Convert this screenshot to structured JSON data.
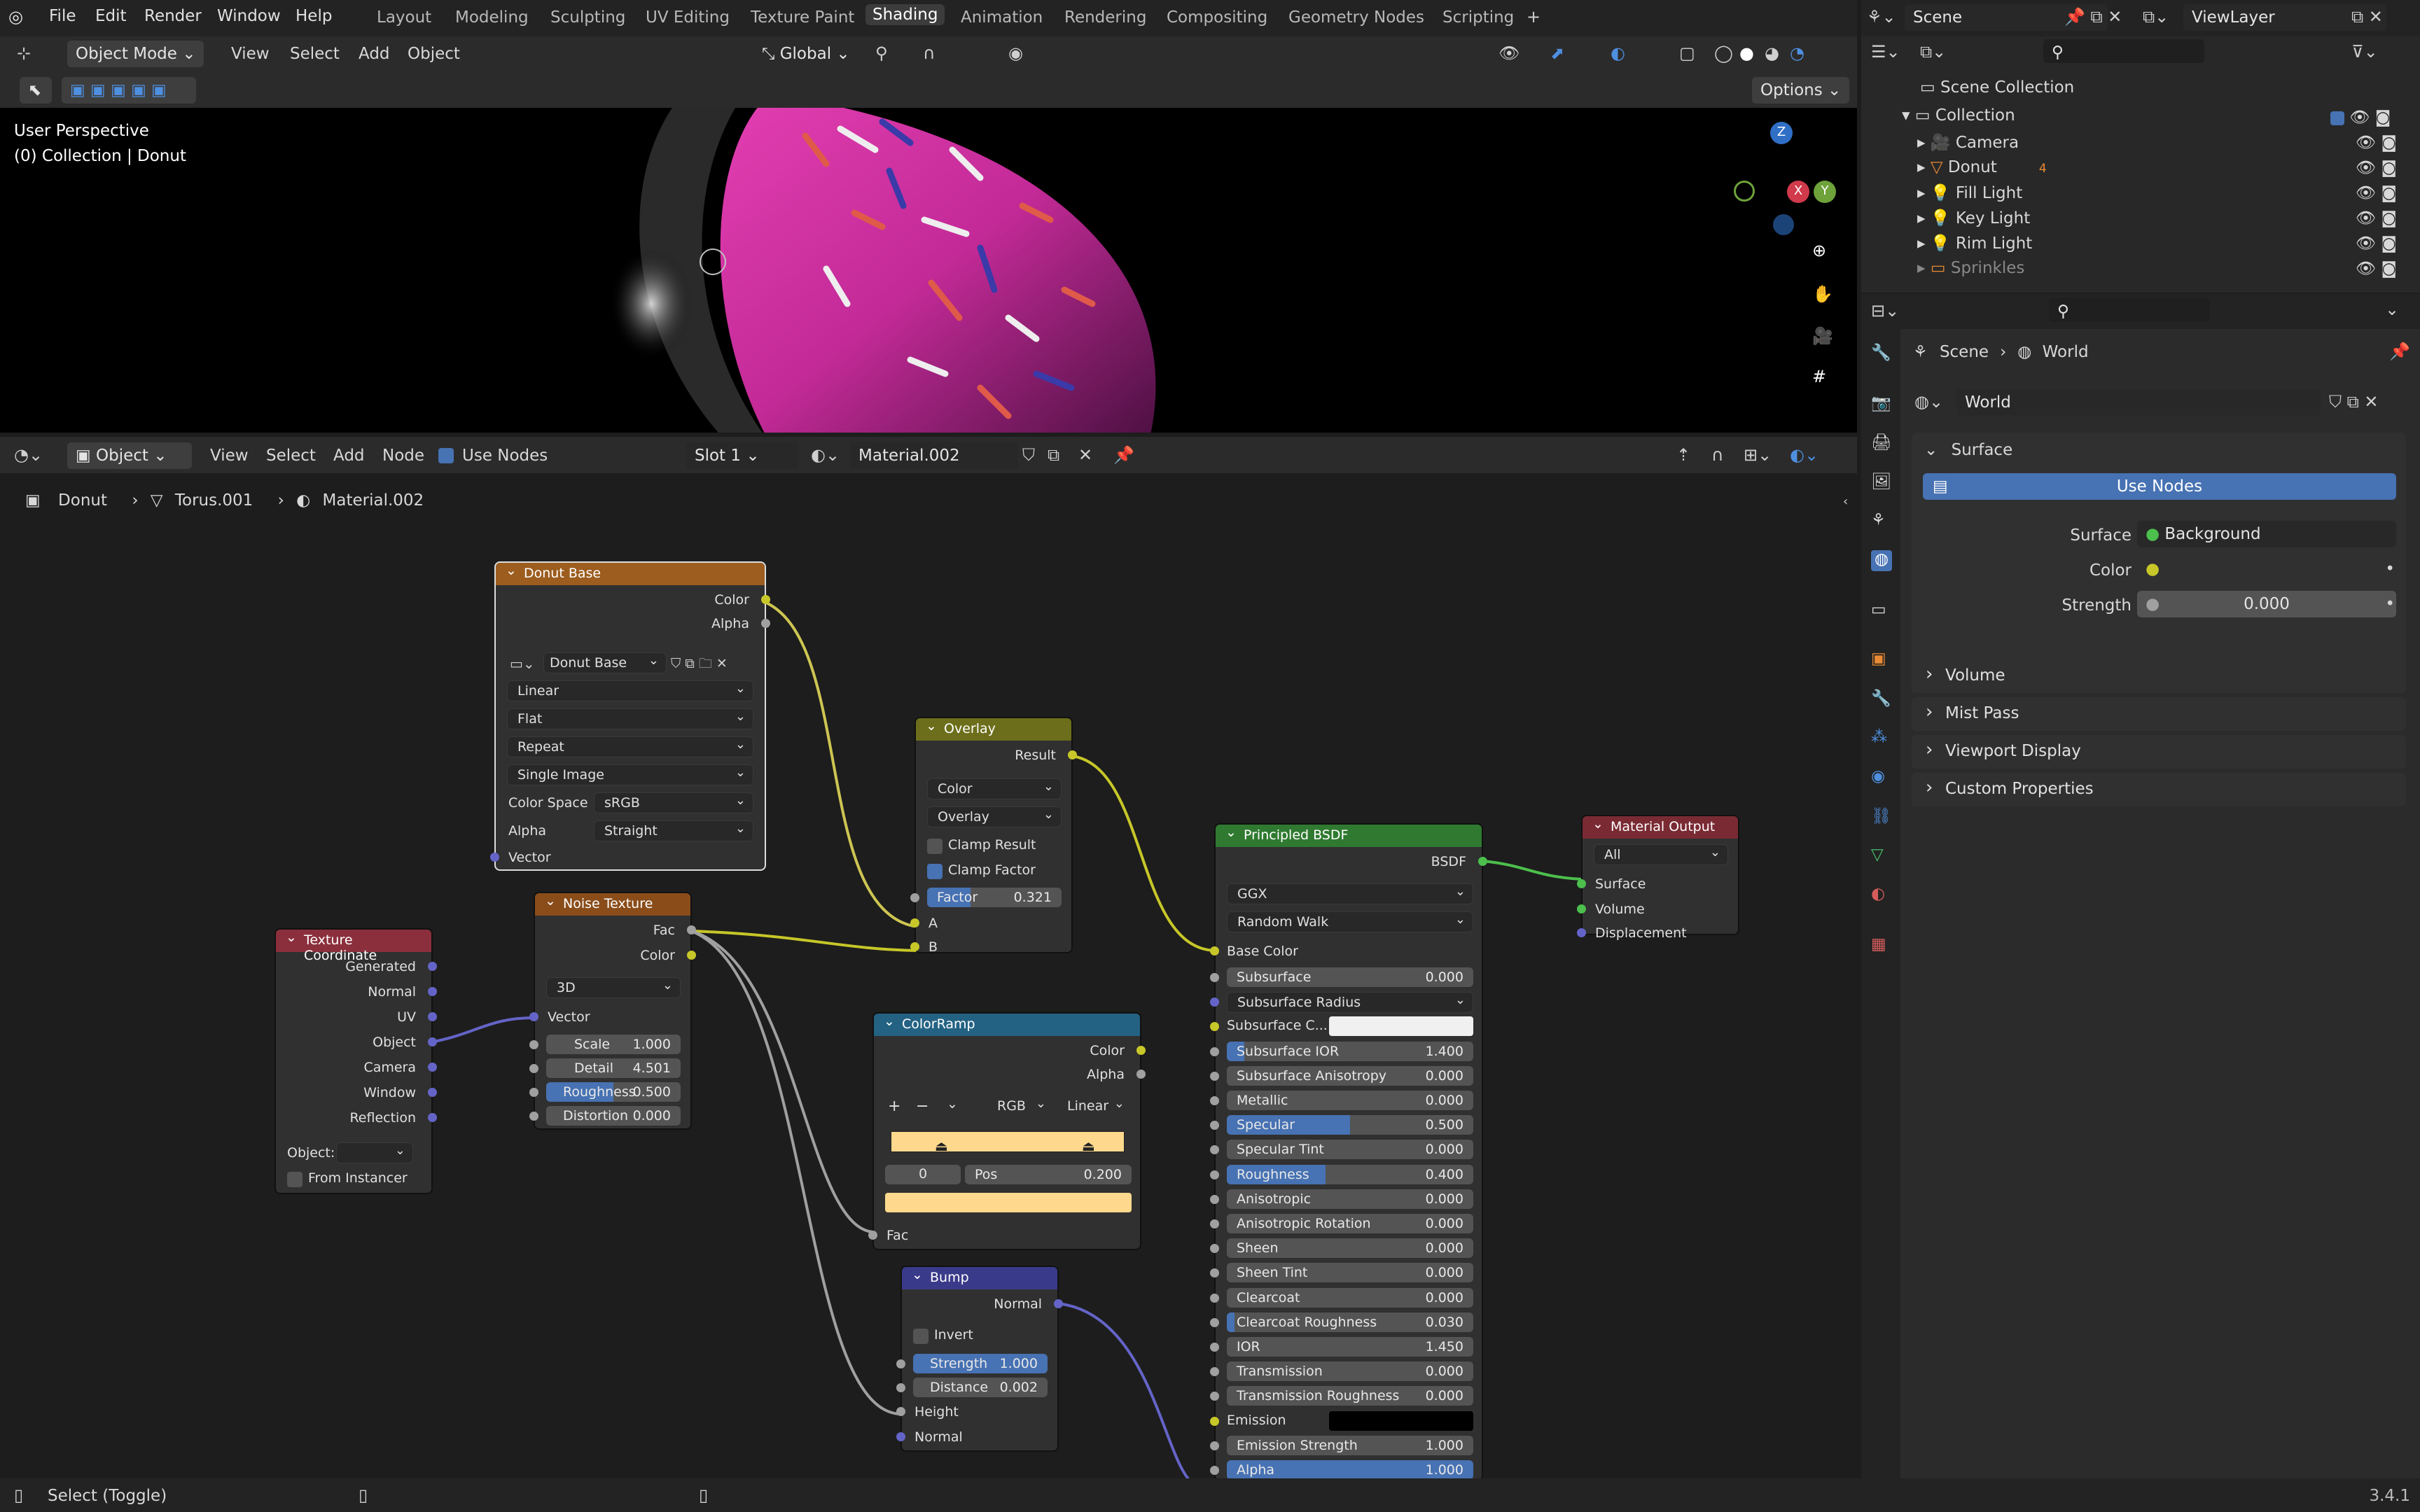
{
  "menu": {
    "file": "File",
    "edit": "Edit",
    "render": "Render",
    "window": "Window",
    "help": "Help"
  },
  "workspaces": [
    "Layout",
    "Modeling",
    "Sculpting",
    "UV Editing",
    "Texture Paint",
    "Shading",
    "Animation",
    "Rendering",
    "Compositing",
    "Geometry Nodes",
    "Scripting"
  ],
  "active_workspace": "Shading",
  "scene_selector": {
    "scene": "Scene",
    "view_layer": "ViewLayer"
  },
  "viewport_header": {
    "mode": "Object Mode",
    "view": "View",
    "select": "Select",
    "add": "Add",
    "object": "Object",
    "transform": "Global",
    "options": "Options"
  },
  "viewport": {
    "perspective": "User Perspective",
    "collection_info": "(0) Collection | Donut",
    "gizmo": {
      "z": "Z",
      "x": "X",
      "y": "Y"
    }
  },
  "node_header": {
    "editor_type": "Object",
    "view": "View",
    "select": "Select",
    "add": "Add",
    "node": "Node",
    "use_nodes": "Use Nodes",
    "slot": "Slot 1",
    "material": "Material.002"
  },
  "breadcrumb": {
    "object": "Donut",
    "mesh": "Torus.001",
    "material": "Material.002"
  },
  "nodes": {
    "donut_base": {
      "title": "Donut Base",
      "color": "Color",
      "alpha": "Alpha",
      "image": "Donut Base",
      "interpolation": "Linear",
      "projection": "Flat",
      "extension": "Repeat",
      "source": "Single Image",
      "color_space_label": "Color Space",
      "color_space": "sRGB",
      "alpha_label": "Alpha",
      "alpha_mode": "Straight",
      "vector": "Vector"
    },
    "overlay": {
      "title": "Overlay",
      "result": "Result",
      "type": "Color",
      "blend": "Overlay",
      "clamp_result": "Clamp Result",
      "clamp_factor": "Clamp Factor",
      "factor_label": "Factor",
      "factor": "0.321",
      "factor_fraction": 0.321,
      "a": "A",
      "b": "B"
    },
    "principled": {
      "title": "Principled BSDF",
      "bsdf": "BSDF",
      "distribution": "GGX",
      "subsurface_method": "Random Walk",
      "base_color": "Base Color",
      "fields": [
        {
          "label": "Subsurface",
          "value": "0.000",
          "fill": 0
        },
        {
          "label": "Subsurface Radius",
          "value": "",
          "dropdown": true
        },
        {
          "label": "Subsurface C...",
          "value": "",
          "colorbox": "#f0f0f0"
        },
        {
          "label": "Subsurface IOR",
          "value": "1.400",
          "fill": 0.07
        },
        {
          "label": "Subsurface Anisotropy",
          "value": "0.000",
          "fill": 0
        },
        {
          "label": "Metallic",
          "value": "0.000",
          "fill": 0
        },
        {
          "label": "Specular",
          "value": "0.500",
          "fill": 0.5
        },
        {
          "label": "Specular Tint",
          "value": "0.000",
          "fill": 0
        },
        {
          "label": "Roughness",
          "value": "0.400",
          "fill": 0.4
        },
        {
          "label": "Anisotropic",
          "value": "0.000",
          "fill": 0
        },
        {
          "label": "Anisotropic Rotation",
          "value": "0.000",
          "fill": 0
        },
        {
          "label": "Sheen",
          "value": "0.000",
          "fill": 0
        },
        {
          "label": "Sheen Tint",
          "value": "0.000",
          "fill": 0
        },
        {
          "label": "Clearcoat",
          "value": "0.000",
          "fill": 0
        },
        {
          "label": "Clearcoat Roughness",
          "value": "0.030",
          "fill": 0.03
        },
        {
          "label": "IOR",
          "value": "1.450",
          "fill": 0
        },
        {
          "label": "Transmission",
          "value": "0.000",
          "fill": 0
        },
        {
          "label": "Transmission Roughness",
          "value": "0.000",
          "fill": 0
        },
        {
          "label": "Emission",
          "value": "",
          "colorbox": "#000000"
        },
        {
          "label": "Emission Strength",
          "value": "1.000",
          "fill": 0
        },
        {
          "label": "Alpha",
          "value": "1.000",
          "fill": 1
        }
      ]
    },
    "material_output": {
      "title": "Material Output",
      "target": "All",
      "surface": "Surface",
      "volume": "Volume",
      "displacement": "Displacement"
    },
    "texture_coordinate": {
      "title": "Texture Coordinate",
      "outputs": [
        "Generated",
        "Normal",
        "UV",
        "Object",
        "Camera",
        "Window",
        "Reflection"
      ],
      "object_label": "Object:",
      "from_instancer": "From Instancer"
    },
    "noise_texture": {
      "title": "Noise Texture",
      "fac": "Fac",
      "color": "Color",
      "dimensions": "3D",
      "vector": "Vector",
      "fields": [
        {
          "label": "Scale",
          "value": "1.000",
          "fill": 0
        },
        {
          "label": "Detail",
          "value": "4.501",
          "fill": 0
        },
        {
          "label": "Roughness",
          "value": "0.500",
          "fill": 0.5
        },
        {
          "label": "Distortion",
          "value": "0.000",
          "fill": 0
        }
      ]
    },
    "color_ramp": {
      "title": "ColorRamp",
      "color": "Color",
      "alpha": "Alpha",
      "plus": "+",
      "minus": "−",
      "color_mode": "RGB",
      "interpolation": "Linear",
      "index": "0",
      "pos_label": "Pos",
      "pos": "0.200",
      "fac": "Fac"
    },
    "bump": {
      "title": "Bump",
      "normal_out": "Normal",
      "invert": "Invert",
      "strength_label": "Strength",
      "strength": "1.000",
      "distance_label": "Distance",
      "distance": "0.002",
      "height": "Height",
      "normal_in": "Normal"
    }
  },
  "outliner": {
    "scene_collection": "Scene Collection",
    "collection": "Collection",
    "items": [
      {
        "label": "Camera",
        "icon": "camera-icon"
      },
      {
        "label": "Donut",
        "icon": "mesh-icon",
        "extra": "4"
      },
      {
        "label": "Fill Light",
        "icon": "light-icon"
      },
      {
        "label": "Key Light",
        "icon": "light-icon"
      },
      {
        "label": "Rim Light",
        "icon": "light-icon"
      },
      {
        "label": "Sprinkles",
        "icon": "collection-icon"
      }
    ]
  },
  "properties": {
    "breadcrumb_scene": "Scene",
    "breadcrumb_world": "World",
    "world_name": "World",
    "surface_panel": "Surface",
    "use_nodes": "Use Nodes",
    "surface_label": "Surface",
    "surface_value": "Background",
    "color_label": "Color",
    "strength_label": "Strength",
    "strength_value": "0.000",
    "panels": [
      "Volume",
      "Mist Pass",
      "Viewport Display",
      "Custom Properties"
    ]
  },
  "status": {
    "hint": "Select (Toggle)",
    "version": "3.4.1"
  },
  "colors": {
    "accent": "#4772b3",
    "node_image": "#9c5d1f",
    "node_texture": "#8a4d1a",
    "node_input": "#8b2f3d",
    "node_converter": "#246283",
    "node_color": "#6c6e1b",
    "node_vector": "#3a3a8a",
    "node_shader": "#2f7a30",
    "node_output": "#7a2a33"
  }
}
